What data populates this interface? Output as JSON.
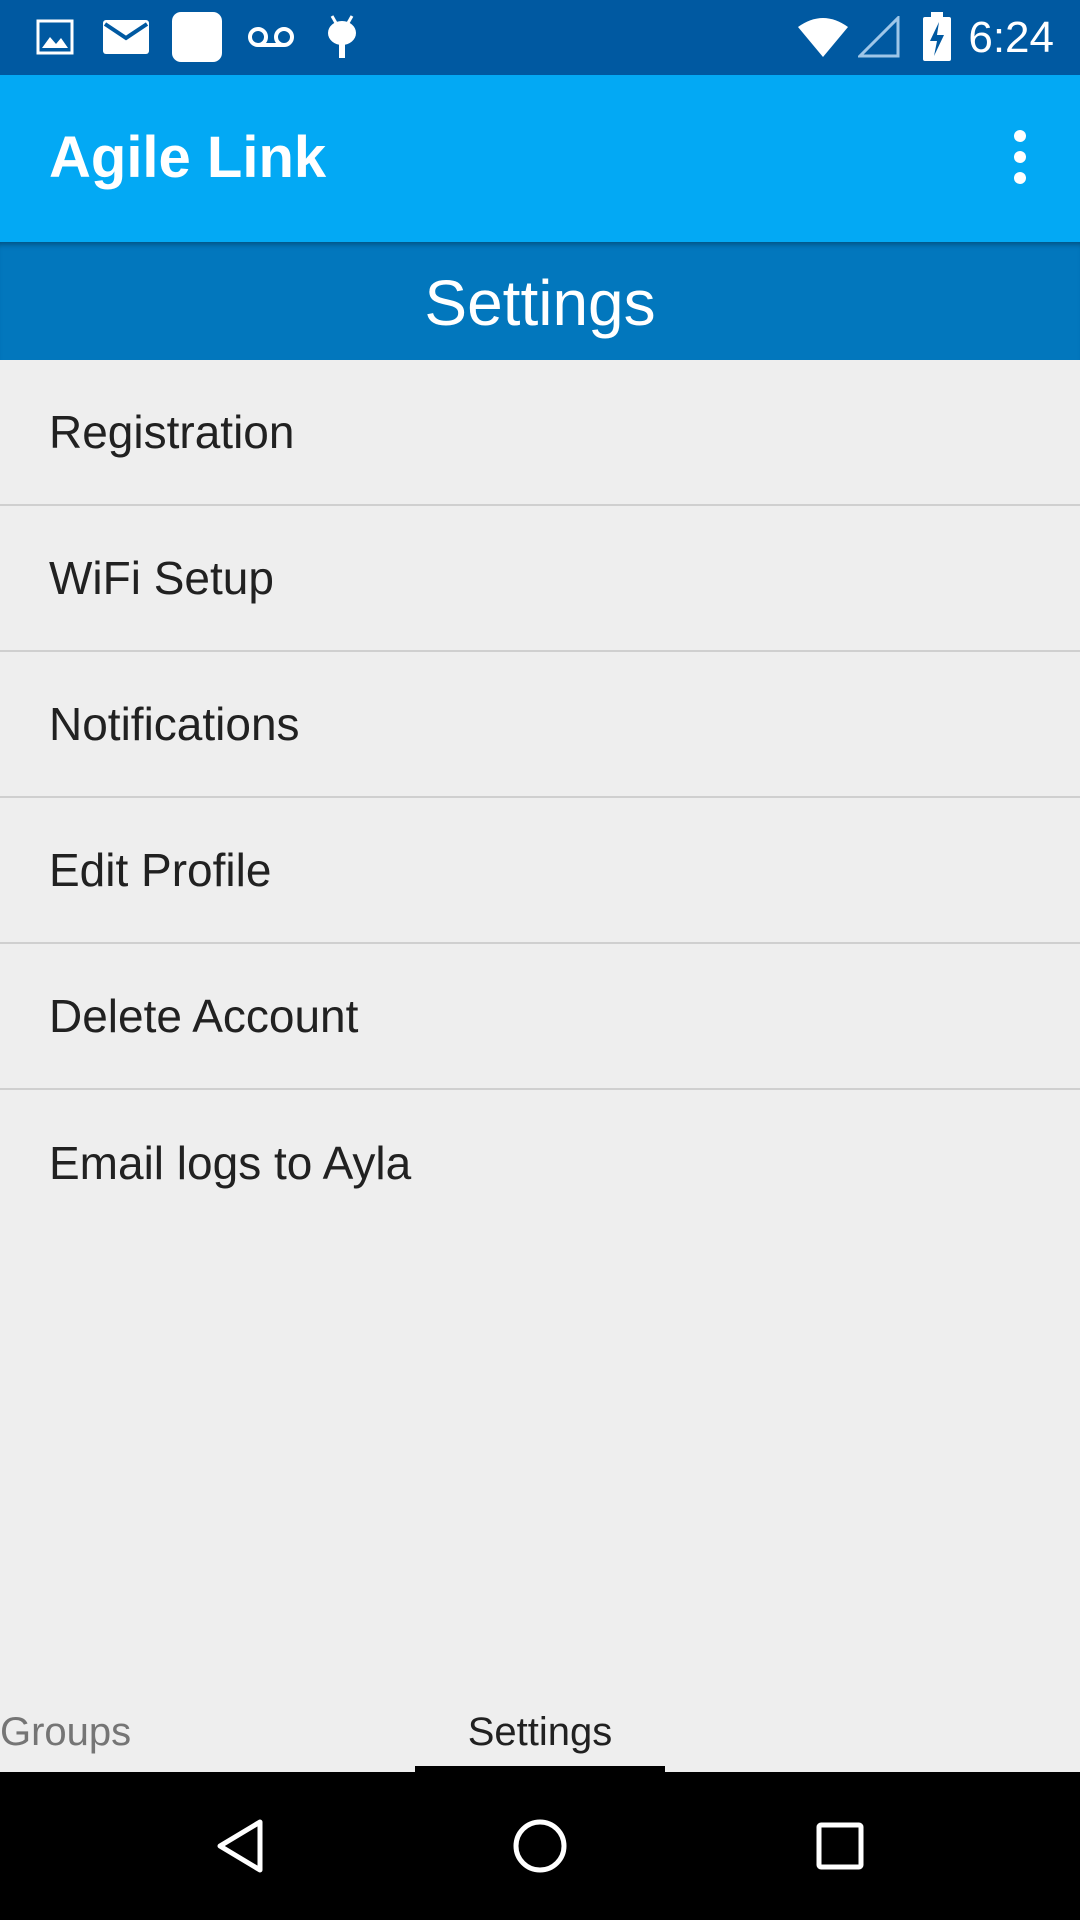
{
  "status_bar": {
    "time": "6:24",
    "left_icons": [
      "image-icon",
      "mail-icon",
      "square-notification-icon",
      "voicemail-icon",
      "android-debug-icon"
    ],
    "right_icons": [
      "wifi-icon",
      "cell-signal-icon",
      "battery-charging-icon"
    ]
  },
  "app_bar": {
    "title": "Agile Link",
    "overflow_icon": "more-vert-icon"
  },
  "section_header": {
    "title": "Settings"
  },
  "settings": {
    "items": [
      {
        "label": "Registration"
      },
      {
        "label": "WiFi Setup"
      },
      {
        "label": "Notifications"
      },
      {
        "label": "Edit Profile"
      },
      {
        "label": "Delete Account"
      },
      {
        "label": "Email logs to Ayla"
      }
    ]
  },
  "tabs": {
    "groups_label": "Groups",
    "settings_label": "Settings",
    "selected": "Settings"
  },
  "nav_bar": {
    "icons": [
      "back-icon",
      "home-icon",
      "recents-icon"
    ]
  },
  "colors": {
    "status_bar": "#0059a1",
    "app_bar": "#03a9f4",
    "section_header": "#0277bd",
    "background": "#eeeeee"
  }
}
